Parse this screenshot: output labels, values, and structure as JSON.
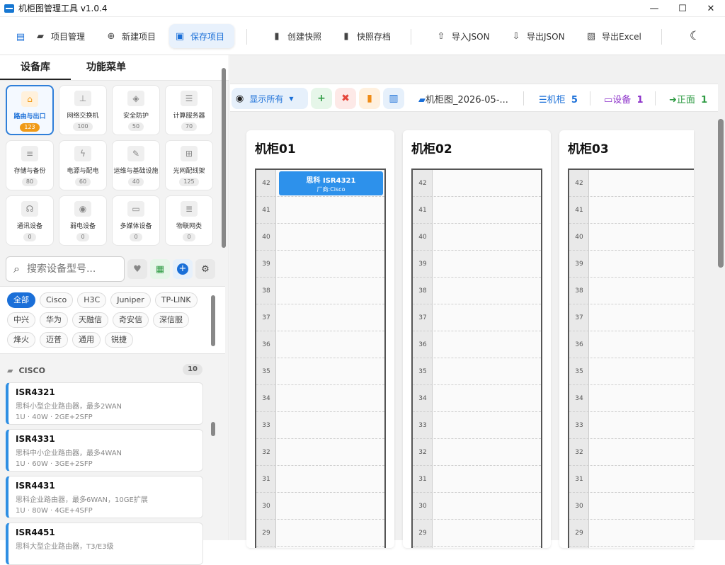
{
  "window": {
    "title": "机柜图管理工具 v1.0.4",
    "min": "—",
    "max": "☐",
    "close": "✕"
  },
  "toolbar": {
    "project_manage": "项目管理",
    "new_project": "新建项目",
    "save_project": "保存项目",
    "create_snapshot": "创建快照",
    "snapshot_archive": "快照存档",
    "import_json": "导入JSON",
    "export_json": "导出JSON",
    "export_excel": "导出Excel"
  },
  "left_tabs": [
    "设备库",
    "功能菜单"
  ],
  "categories": [
    {
      "label": "路由与出口",
      "count": "123",
      "icon": "router-icon"
    },
    {
      "label": "网络交换机",
      "count": "100",
      "icon": "switch-icon"
    },
    {
      "label": "安全防护",
      "count": "50",
      "icon": "shield-icon"
    },
    {
      "label": "计算服务器",
      "count": "70",
      "icon": "server-icon"
    },
    {
      "label": "存储与备份",
      "count": "80",
      "icon": "database-icon"
    },
    {
      "label": "电源与配电",
      "count": "60",
      "icon": "plug-icon"
    },
    {
      "label": "运维与基础设施",
      "count": "40",
      "icon": "wrench-icon"
    },
    {
      "label": "光网配线架",
      "count": "125",
      "icon": "patch-panel-icon"
    },
    {
      "label": "通讯设备",
      "count": "0",
      "icon": "antenna-icon"
    },
    {
      "label": "弱电设备",
      "count": "0",
      "icon": "signal-icon"
    },
    {
      "label": "多媒体设备",
      "count": "0",
      "icon": "projector-icon"
    },
    {
      "label": "物联网类",
      "count": "0",
      "icon": "iot-icon"
    }
  ],
  "search": {
    "placeholder": "搜索设备型号..."
  },
  "brands": [
    "全部",
    "Cisco",
    "H3C",
    "Juniper",
    "TP-LINK",
    "中兴",
    "华为",
    "天融信",
    "奇安信",
    "深信服",
    "烽火",
    "迈普",
    "通用",
    "锐捷"
  ],
  "device_group": {
    "name": "CISCO",
    "count": "10"
  },
  "devices": [
    {
      "name": "ISR4321",
      "desc": "思科小型企业路由器，最多2WAN",
      "spec": "1U · 40W · 2GE+2SFP"
    },
    {
      "name": "ISR4331",
      "desc": "思科中小企业路由器，最多4WAN",
      "spec": "1U · 60W · 3GE+2SFP"
    },
    {
      "name": "ISR4431",
      "desc": "思科企业路由器，最多6WAN，10GE扩展",
      "spec": "1U · 80W · 4GE+4SFP"
    },
    {
      "name": "ISR4451",
      "desc": "思科大型企业路由器，T3/E3级",
      "spec": ""
    }
  ],
  "rack_bar": {
    "show_all": "显示所有",
    "diagram_name": "机柜图_2026-05-...",
    "cabinet_label": "机柜",
    "cabinet_count": "5",
    "device_label": "设备",
    "device_count": "1",
    "front_label": "正面",
    "front_count": "1"
  },
  "cabinets": [
    {
      "title": "机柜01",
      "units": [
        "42",
        "41",
        "40",
        "39",
        "38",
        "37",
        "36",
        "35",
        "34",
        "33",
        "32",
        "31",
        "30",
        "29"
      ],
      "device": {
        "name": "思科 ISR4321",
        "vendor": "厂商:Cisco"
      }
    },
    {
      "title": "机柜02",
      "units": [
        "42",
        "41",
        "40",
        "39",
        "38",
        "37",
        "36",
        "35",
        "34",
        "33",
        "32",
        "31",
        "30",
        "29"
      ]
    },
    {
      "title": "机柜03",
      "units": [
        "42",
        "41",
        "40",
        "39",
        "38",
        "37",
        "36",
        "35",
        "34",
        "33",
        "32",
        "31",
        "30",
        "29"
      ]
    }
  ]
}
